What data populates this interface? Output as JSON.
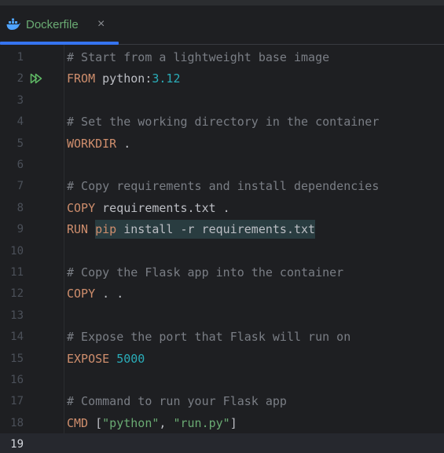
{
  "tab": {
    "label": "Dockerfile",
    "close_glyph": "×",
    "icon": "docker-whale-icon"
  },
  "colors": {
    "background": "#1e1f22",
    "accent": "#3574f0",
    "comment": "#7a7e85",
    "keyword": "#cf8e6d",
    "number": "#2aacb8",
    "string": "#6aab73",
    "text": "#bcbec4"
  },
  "editor": {
    "current_line": 19,
    "lines": [
      {
        "n": "1",
        "parts": [
          {
            "t": "# Start from a lightweight base image",
            "c": "cm"
          }
        ]
      },
      {
        "n": "2",
        "parts": [
          {
            "t": "FROM",
            "c": "kw"
          },
          {
            "t": " python:",
            "c": "pl"
          },
          {
            "t": "3.12",
            "c": "num"
          }
        ]
      },
      {
        "n": "3",
        "parts": []
      },
      {
        "n": "4",
        "parts": [
          {
            "t": "# Set the working directory in the container",
            "c": "cm"
          }
        ]
      },
      {
        "n": "5",
        "parts": [
          {
            "t": "WORKDIR",
            "c": "kw"
          },
          {
            "t": " .",
            "c": "pl"
          }
        ]
      },
      {
        "n": "6",
        "parts": []
      },
      {
        "n": "7",
        "parts": [
          {
            "t": "# Copy requirements and install dependencies",
            "c": "cm"
          }
        ]
      },
      {
        "n": "8",
        "parts": [
          {
            "t": "COPY",
            "c": "kw"
          },
          {
            "t": " requirements.txt .",
            "c": "pl"
          }
        ]
      },
      {
        "n": "9",
        "parts": [
          {
            "t": "RUN",
            "c": "kw"
          },
          {
            "t": " ",
            "c": "pl"
          },
          {
            "t": "pip",
            "c": "kw hl"
          },
          {
            "t": " install -r requirements.txt",
            "c": "pl hl"
          }
        ]
      },
      {
        "n": "10",
        "parts": []
      },
      {
        "n": "11",
        "parts": [
          {
            "t": "# Copy the Flask app into the container",
            "c": "cm"
          }
        ]
      },
      {
        "n": "12",
        "parts": [
          {
            "t": "COPY",
            "c": "kw"
          },
          {
            "t": " . .",
            "c": "pl"
          }
        ]
      },
      {
        "n": "13",
        "parts": []
      },
      {
        "n": "14",
        "parts": [
          {
            "t": "# Expose the port that Flask will run on",
            "c": "cm"
          }
        ]
      },
      {
        "n": "15",
        "parts": [
          {
            "t": "EXPOSE",
            "c": "kw"
          },
          {
            "t": " ",
            "c": "pl"
          },
          {
            "t": "5000",
            "c": "num"
          }
        ]
      },
      {
        "n": "16",
        "parts": []
      },
      {
        "n": "17",
        "parts": [
          {
            "t": "# Command to run your Flask app",
            "c": "cm"
          }
        ]
      },
      {
        "n": "18",
        "parts": [
          {
            "t": "CMD",
            "c": "kw"
          },
          {
            "t": " [",
            "c": "pl"
          },
          {
            "t": "\"python\"",
            "c": "str"
          },
          {
            "t": ", ",
            "c": "pl"
          },
          {
            "t": "\"run.py\"",
            "c": "str"
          },
          {
            "t": "]",
            "c": "pl"
          }
        ]
      },
      {
        "n": "19",
        "parts": []
      }
    ],
    "run_gutter_line": 2,
    "run_icon": "run-double-play-icon"
  }
}
